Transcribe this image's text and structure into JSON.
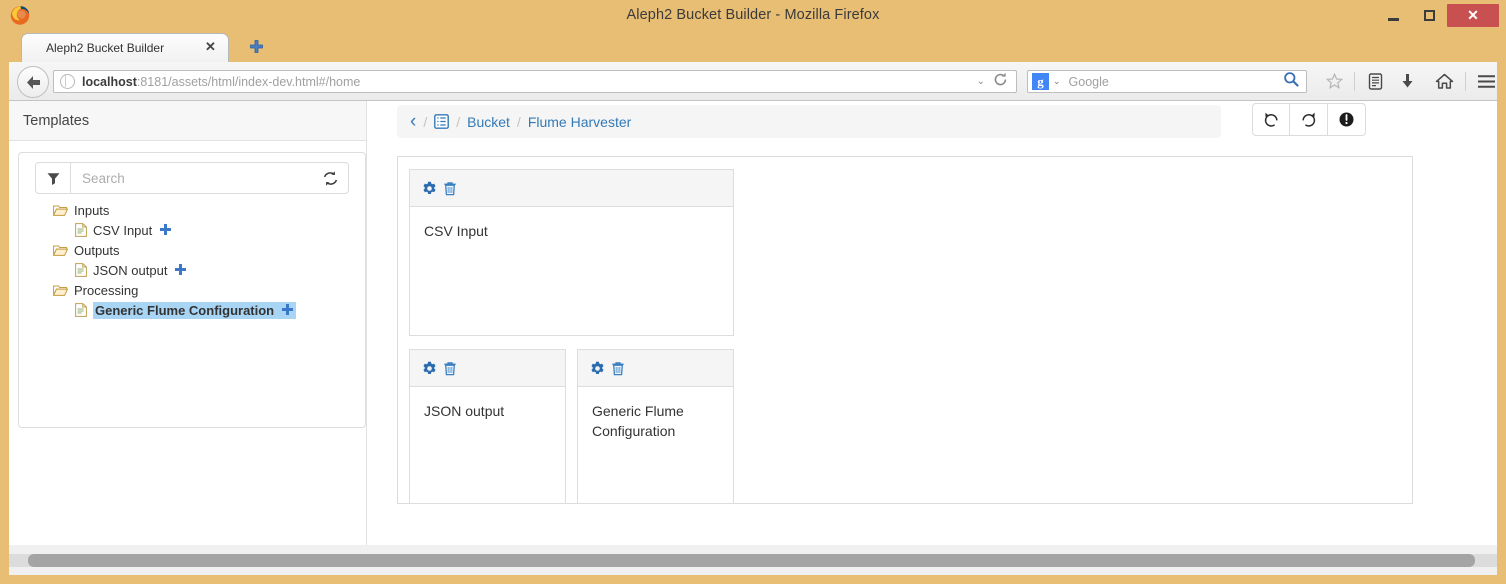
{
  "window": {
    "title": "Aleph2 Bucket Builder - Mozilla Firefox",
    "minimize_label": "–",
    "maximize_label": "",
    "close_label": "✕"
  },
  "tabs": {
    "items": [
      {
        "label": "Aleph2 Bucket Builder",
        "close_label": "✕"
      }
    ],
    "new_tab_label": "＋"
  },
  "navbar": {
    "back_label": "←",
    "url_host": "localhost",
    "url_rest": ":8181/assets/html/index-dev.html#/home",
    "url_dropdown": "⌄",
    "reload_label": "⟳",
    "search_engine_letter": "g",
    "search_engine_chevron": "⌄",
    "search_placeholder": "Google",
    "icons": {
      "bookmark": "☆",
      "reader": "reader-list-icon",
      "download": "⬇",
      "home": "⌂",
      "menu": "☰"
    }
  },
  "sidebar": {
    "header": "Templates",
    "search": {
      "placeholder": "Search",
      "filter_icon": "funnel-icon",
      "refresh_icon": "refresh-icon"
    },
    "tree": [
      {
        "type": "folder",
        "label": "Inputs"
      },
      {
        "type": "leaf",
        "label": "CSV Input",
        "plus": "＋",
        "selected": false
      },
      {
        "type": "folder",
        "label": "Outputs"
      },
      {
        "type": "leaf",
        "label": "JSON output",
        "plus": "＋",
        "selected": false
      },
      {
        "type": "folder",
        "label": "Processing"
      },
      {
        "type": "leaf",
        "label": "Generic Flume Configuration",
        "plus": "＋",
        "selected": true
      }
    ]
  },
  "main": {
    "breadcrumb": {
      "back_icon": "‹",
      "list_icon": "list-icon",
      "sep": "/",
      "items": [
        {
          "label": "Bucket"
        },
        {
          "label": "Flume Harvester"
        }
      ]
    },
    "actions": [
      {
        "name": "undo",
        "icon": "↺"
      },
      {
        "name": "redo",
        "icon": "↻"
      },
      {
        "name": "info",
        "icon": "!"
      }
    ],
    "cards": [
      {
        "title": "CSV Input",
        "gear": "gear-icon",
        "trash": "trash-icon"
      },
      {
        "title": "JSON output",
        "gear": "gear-icon",
        "trash": "trash-icon"
      },
      {
        "title": "Generic Flume Configuration",
        "gear": "gear-icon",
        "trash": "trash-icon"
      }
    ]
  },
  "colors": {
    "chrome": "#e8bd74",
    "accent": "#337ab7",
    "selection": "#a9d5f5",
    "close_button": "#c85050"
  }
}
